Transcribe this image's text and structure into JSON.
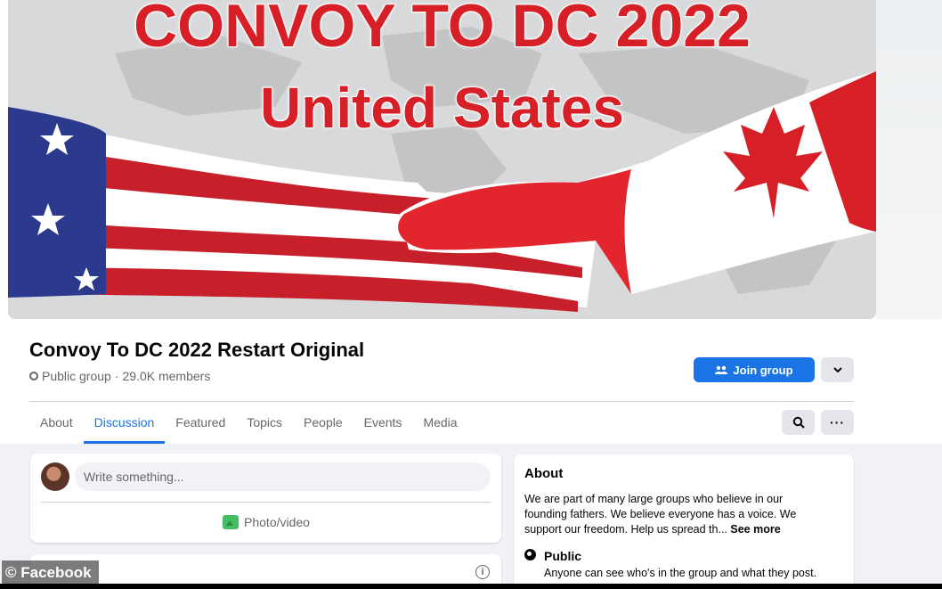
{
  "cover": {
    "line1": "CONVOY TO DC 2022",
    "line2": "United States"
  },
  "group": {
    "name": "Convoy To DC 2022 Restart Original",
    "privacy": "Public group",
    "separator": "·",
    "members": "29.0K members"
  },
  "actions": {
    "join_label": "Join group",
    "join_icon": "people-icon",
    "dropdown_icon": "chevron-down-icon",
    "more_label": "···"
  },
  "tabs": [
    {
      "label": "About"
    },
    {
      "label": "Discussion",
      "active": true
    },
    {
      "label": "Featured"
    },
    {
      "label": "Topics"
    },
    {
      "label": "People"
    },
    {
      "label": "Events"
    },
    {
      "label": "Media"
    }
  ],
  "composer": {
    "placeholder": "Write something...",
    "photo_label": "Photo/video"
  },
  "about": {
    "title": "About",
    "text": "We are part of many large groups who believe in our founding fathers. We believe everyone has a voice. We support our freedom. Help us spread th...",
    "see_more": "See more",
    "public_title": "Public",
    "public_desc": "Anyone can see who's in the group and what they post."
  },
  "watermark": "© Facebook",
  "colors": {
    "accent": "#1b74e4",
    "flag_red": "#d61f26",
    "flag_blue": "#2b3a8c"
  }
}
